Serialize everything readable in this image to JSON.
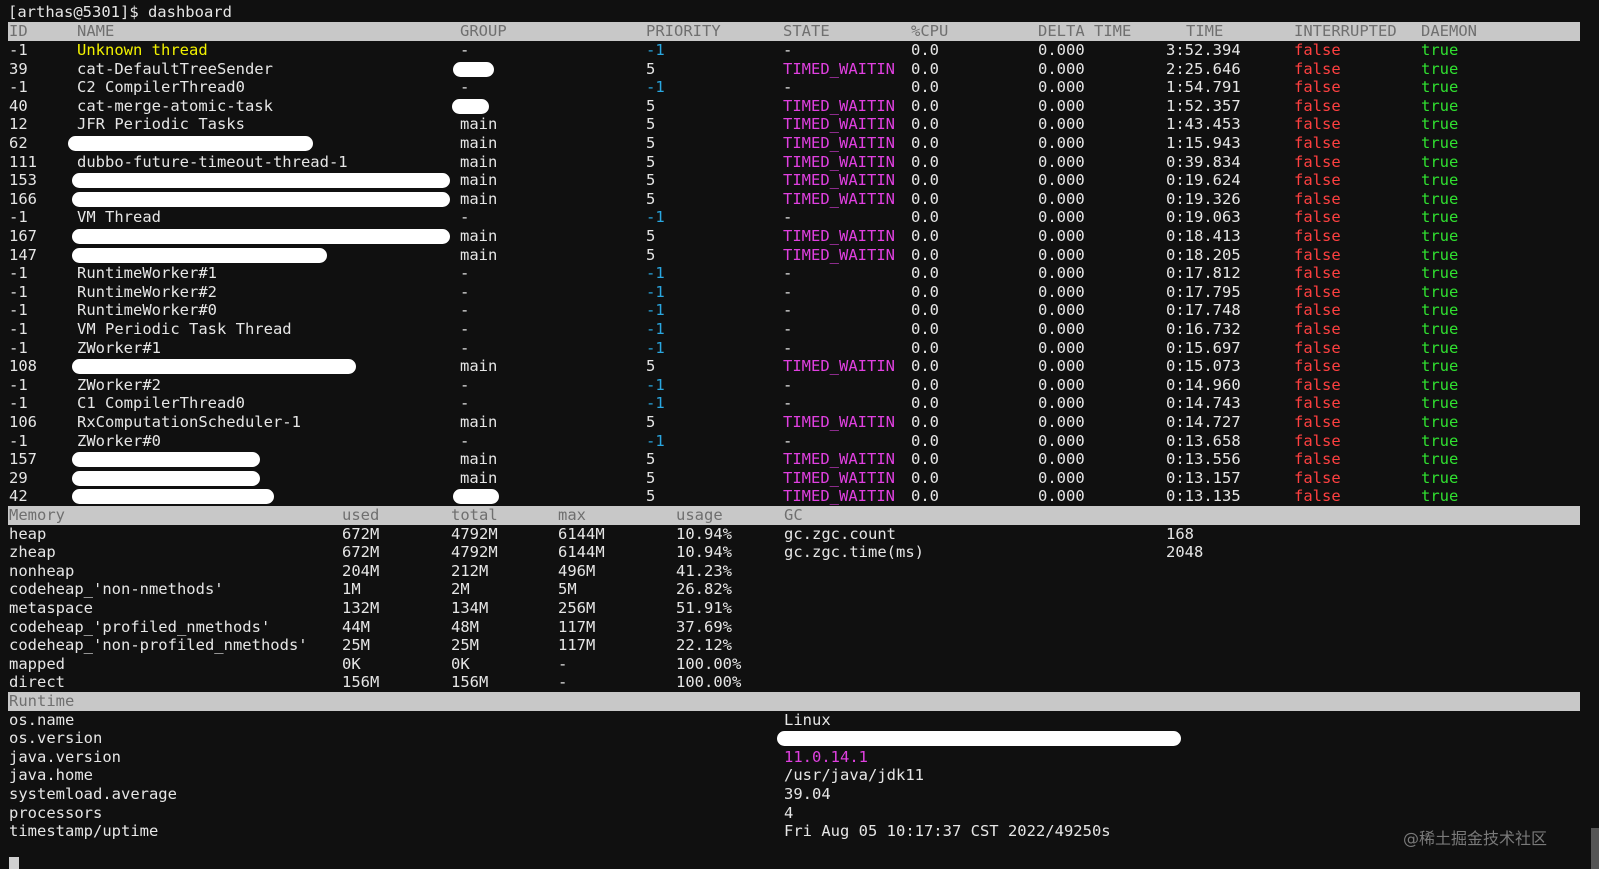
{
  "prompt": "[arthas@5301]$ dashboard",
  "thread_headers": [
    "ID",
    "NAME",
    "GROUP",
    "PRIORITY",
    "STATE",
    "%CPU",
    "DELTA TIME",
    "TIME",
    "INTERRUPTED",
    "DAEMON"
  ],
  "threads": [
    {
      "id": "-1",
      "name": "Unknown thread",
      "group": "-",
      "priority": "-1",
      "state": "-",
      "cpu": "0.0",
      "delta": "0.000",
      "time": "3:52.394",
      "interrupted": "false",
      "daemon": "true"
    },
    {
      "id": "39",
      "name": "cat-DefaultTreeSender",
      "group": "",
      "priority": "5",
      "state": "TIMED_WAITIN",
      "cpu": "0.0",
      "delta": "0.000",
      "time": "2:25.646",
      "interrupted": "false",
      "daemon": "true"
    },
    {
      "id": "-1",
      "name": "C2 CompilerThread0",
      "group": "-",
      "priority": "-1",
      "state": "-",
      "cpu": "0.0",
      "delta": "0.000",
      "time": "1:54.791",
      "interrupted": "false",
      "daemon": "true"
    },
    {
      "id": "40",
      "name": "cat-merge-atomic-task",
      "group": "",
      "priority": "5",
      "state": "TIMED_WAITIN",
      "cpu": "0.0",
      "delta": "0.000",
      "time": "1:52.357",
      "interrupted": "false",
      "daemon": "true"
    },
    {
      "id": "12",
      "name": "JFR Periodic Tasks",
      "group": "main",
      "priority": "5",
      "state": "TIMED_WAITIN",
      "cpu": "0.0",
      "delta": "0.000",
      "time": "1:43.453",
      "interrupted": "false",
      "daemon": "true"
    },
    {
      "id": "62",
      "name": "",
      "group": "main",
      "priority": "5",
      "state": "TIMED_WAITIN",
      "cpu": "0.0",
      "delta": "0.000",
      "time": "1:15.943",
      "interrupted": "false",
      "daemon": "true"
    },
    {
      "id": "111",
      "name": "dubbo-future-timeout-thread-1",
      "group": "main",
      "priority": "5",
      "state": "TIMED_WAITIN",
      "cpu": "0.0",
      "delta": "0.000",
      "time": "0:39.834",
      "interrupted": "false",
      "daemon": "true"
    },
    {
      "id": "153",
      "name": "",
      "group": "main",
      "priority": "5",
      "state": "TIMED_WAITIN",
      "cpu": "0.0",
      "delta": "0.000",
      "time": "0:19.624",
      "interrupted": "false",
      "daemon": "true"
    },
    {
      "id": "166",
      "name": "",
      "group": "main",
      "priority": "5",
      "state": "TIMED_WAITIN",
      "cpu": "0.0",
      "delta": "0.000",
      "time": "0:19.326",
      "interrupted": "false",
      "daemon": "true"
    },
    {
      "id": "-1",
      "name": "VM Thread",
      "group": "-",
      "priority": "-1",
      "state": "-",
      "cpu": "0.0",
      "delta": "0.000",
      "time": "0:19.063",
      "interrupted": "false",
      "daemon": "true"
    },
    {
      "id": "167",
      "name": "",
      "group": "main",
      "priority": "5",
      "state": "TIMED_WAITIN",
      "cpu": "0.0",
      "delta": "0.000",
      "time": "0:18.413",
      "interrupted": "false",
      "daemon": "true"
    },
    {
      "id": "147",
      "name": "",
      "group": "main",
      "priority": "5",
      "state": "TIMED_WAITIN",
      "cpu": "0.0",
      "delta": "0.000",
      "time": "0:18.205",
      "interrupted": "false",
      "daemon": "true"
    },
    {
      "id": "-1",
      "name": "RuntimeWorker#1",
      "group": "-",
      "priority": "-1",
      "state": "-",
      "cpu": "0.0",
      "delta": "0.000",
      "time": "0:17.812",
      "interrupted": "false",
      "daemon": "true"
    },
    {
      "id": "-1",
      "name": "RuntimeWorker#2",
      "group": "-",
      "priority": "-1",
      "state": "-",
      "cpu": "0.0",
      "delta": "0.000",
      "time": "0:17.795",
      "interrupted": "false",
      "daemon": "true"
    },
    {
      "id": "-1",
      "name": "RuntimeWorker#0",
      "group": "-",
      "priority": "-1",
      "state": "-",
      "cpu": "0.0",
      "delta": "0.000",
      "time": "0:17.748",
      "interrupted": "false",
      "daemon": "true"
    },
    {
      "id": "-1",
      "name": "VM Periodic Task Thread",
      "group": "-",
      "priority": "-1",
      "state": "-",
      "cpu": "0.0",
      "delta": "0.000",
      "time": "0:16.732",
      "interrupted": "false",
      "daemon": "true"
    },
    {
      "id": "-1",
      "name": "ZWorker#1",
      "group": "-",
      "priority": "-1",
      "state": "-",
      "cpu": "0.0",
      "delta": "0.000",
      "time": "0:15.697",
      "interrupted": "false",
      "daemon": "true"
    },
    {
      "id": "108",
      "name": "",
      "group": "main",
      "priority": "5",
      "state": "TIMED_WAITIN",
      "cpu": "0.0",
      "delta": "0.000",
      "time": "0:15.073",
      "interrupted": "false",
      "daemon": "true"
    },
    {
      "id": "-1",
      "name": "ZWorker#2",
      "group": "-",
      "priority": "-1",
      "state": "-",
      "cpu": "0.0",
      "delta": "0.000",
      "time": "0:14.960",
      "interrupted": "false",
      "daemon": "true"
    },
    {
      "id": "-1",
      "name": "C1 CompilerThread0",
      "group": "-",
      "priority": "-1",
      "state": "-",
      "cpu": "0.0",
      "delta": "0.000",
      "time": "0:14.743",
      "interrupted": "false",
      "daemon": "true"
    },
    {
      "id": "106",
      "name": "RxComputationScheduler-1",
      "group": "main",
      "priority": "5",
      "state": "TIMED_WAITIN",
      "cpu": "0.0",
      "delta": "0.000",
      "time": "0:14.727",
      "interrupted": "false",
      "daemon": "true"
    },
    {
      "id": "-1",
      "name": "ZWorker#0",
      "group": "-",
      "priority": "-1",
      "state": "-",
      "cpu": "0.0",
      "delta": "0.000",
      "time": "0:13.658",
      "interrupted": "false",
      "daemon": "true"
    },
    {
      "id": "157",
      "name": "",
      "group": "main",
      "priority": "5",
      "state": "TIMED_WAITIN",
      "cpu": "0.0",
      "delta": "0.000",
      "time": "0:13.556",
      "interrupted": "false",
      "daemon": "true"
    },
    {
      "id": "29",
      "name": "",
      "group": "main",
      "priority": "5",
      "state": "TIMED_WAITIN",
      "cpu": "0.0",
      "delta": "0.000",
      "time": "0:13.157",
      "interrupted": "false",
      "daemon": "true"
    },
    {
      "id": "42",
      "name": "",
      "group": "",
      "priority": "5",
      "state": "TIMED_WAITIN",
      "cpu": "0.0",
      "delta": "0.000",
      "time": "0:13.135",
      "interrupted": "false",
      "daemon": "true"
    }
  ],
  "memory_headers": [
    "Memory",
    "used",
    "total",
    "max",
    "usage",
    "GC"
  ],
  "memory": [
    {
      "name": "heap",
      "used": "672M",
      "total": "4792M",
      "max": "6144M",
      "usage": "10.94%",
      "gc_key": "gc.zgc.count",
      "gc_val": "168"
    },
    {
      "name": "zheap",
      "used": "672M",
      "total": "4792M",
      "max": "6144M",
      "usage": "10.94%",
      "gc_key": "gc.zgc.time(ms)",
      "gc_val": "2048"
    },
    {
      "name": "nonheap",
      "used": "204M",
      "total": "212M",
      "max": "496M",
      "usage": "41.23%",
      "gc_key": "",
      "gc_val": ""
    },
    {
      "name": "codeheap_'non-nmethods'",
      "used": "1M",
      "total": "2M",
      "max": "5M",
      "usage": "26.82%",
      "gc_key": "",
      "gc_val": ""
    },
    {
      "name": "metaspace",
      "used": "132M",
      "total": "134M",
      "max": "256M",
      "usage": "51.91%",
      "gc_key": "",
      "gc_val": ""
    },
    {
      "name": "codeheap_'profiled_nmethods'",
      "used": "44M",
      "total": "48M",
      "max": "117M",
      "usage": "37.69%",
      "gc_key": "",
      "gc_val": ""
    },
    {
      "name": "codeheap_'non-profiled_nmethods'",
      "used": "25M",
      "total": "25M",
      "max": "117M",
      "usage": "22.12%",
      "gc_key": "",
      "gc_val": ""
    },
    {
      "name": "mapped",
      "used": "0K",
      "total": "0K",
      "max": "-",
      "usage": "100.00%",
      "gc_key": "",
      "gc_val": ""
    },
    {
      "name": "direct",
      "used": "156M",
      "total": "156M",
      "max": "-",
      "usage": "100.00%",
      "gc_key": "",
      "gc_val": ""
    }
  ],
  "runtime_header": "Runtime",
  "runtime": [
    {
      "key": "os.name",
      "value": "Linux",
      "color": "default"
    },
    {
      "key": "os.version",
      "value": "",
      "color": "default"
    },
    {
      "key": "java.version",
      "value": "11.0.14.1",
      "color": "magenta"
    },
    {
      "key": "java.home",
      "value": "/usr/java/jdk11",
      "color": "default"
    },
    {
      "key": "systemload.average",
      "value": "39.04",
      "color": "default"
    },
    {
      "key": "processors",
      "value": "4",
      "color": "default"
    },
    {
      "key": "timestamp/uptime",
      "value": "Fri Aug 05 10:17:37 CST 2022/49250s",
      "color": "default"
    }
  ],
  "watermark": "@稀土掘金技术社区",
  "colors": {
    "background": "#101010",
    "header_bg": "#c8c8c8",
    "false": "#ff4040",
    "true": "#30e030",
    "timed_waiting": "#e040e0",
    "neg_priority": "#2aa7e0",
    "unknown": "#f2f200"
  }
}
